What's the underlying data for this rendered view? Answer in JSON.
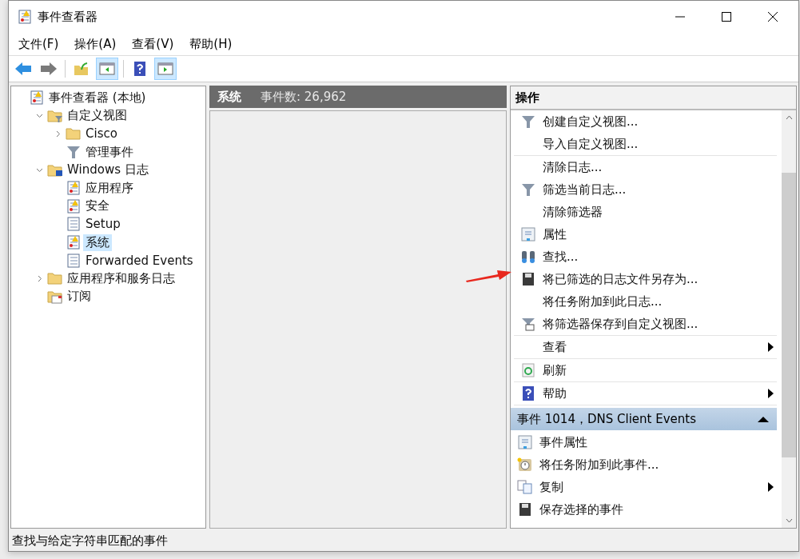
{
  "window": {
    "title": "事件查看器"
  },
  "menu": [
    {
      "label": "文件(F)"
    },
    {
      "label": "操作(A)"
    },
    {
      "label": "查看(V)"
    },
    {
      "label": "帮助(H)"
    }
  ],
  "toolbar": [
    {
      "on": false
    },
    {
      "on": false
    },
    {
      "on": false
    },
    {
      "on": true
    },
    {
      "on": false
    },
    {
      "on": true
    }
  ],
  "tree": [
    {
      "label": "事件查看器 (本地)",
      "selected": false,
      "children": [
        {
          "label": "自定义视图",
          "selected": false,
          "expanded": true,
          "children": [
            {
              "label": "Cisco",
              "selected": false,
              "expanded": false
            },
            {
              "label": "管理事件",
              "selected": false
            }
          ]
        },
        {
          "label": "Windows 日志",
          "selected": false,
          "expanded": true,
          "children": [
            {
              "label": "应用程序",
              "selected": false
            },
            {
              "label": "安全",
              "selected": false
            },
            {
              "label": "Setup",
              "selected": false
            },
            {
              "label": "系统",
              "selected": true
            },
            {
              "label": "Forwarded Events",
              "selected": false
            }
          ]
        },
        {
          "label": "应用程序和服务日志",
          "selected": false,
          "expanded": false
        },
        {
          "label": "订阅",
          "selected": false
        }
      ]
    }
  ],
  "log_header": {
    "name": "系统",
    "count": "事件数: 26,962"
  },
  "actions": {
    "title": "操作",
    "groups": [
      [
        {
          "label": "创建自定义视图...",
          "submenu": false
        },
        {
          "label": "导入自定义视图...",
          "submenu": false
        }
      ],
      [
        {
          "label": "清除日志...",
          "submenu": false
        },
        {
          "label": "筛选当前日志...",
          "submenu": false
        },
        {
          "label": "清除筛选器",
          "submenu": false
        },
        {
          "label": "属性",
          "submenu": false
        },
        {
          "label": "查找...",
          "submenu": false
        },
        {
          "label": "将已筛选的日志文件另存为...",
          "submenu": false
        },
        {
          "label": "将任务附加到此日志...",
          "submenu": false
        },
        {
          "label": "将筛选器保存到自定义视图...",
          "submenu": false
        }
      ],
      [
        {
          "label": "查看",
          "submenu": true
        }
      ],
      [
        {
          "label": "刷新",
          "submenu": false
        }
      ],
      [
        {
          "label": "帮助",
          "submenu": true
        }
      ]
    ],
    "section": {
      "title": "事件 1014，DNS Client Events",
      "expanded": true,
      "items": [
        {
          "label": "事件属性",
          "submenu": false
        },
        {
          "label": "将任务附加到此事件...",
          "submenu": false
        },
        {
          "label": "复制",
          "submenu": true
        },
        {
          "label": "保存选择的事件",
          "submenu": false
        }
      ]
    }
  },
  "status_bar": "查找与给定字符串匹配的事件"
}
